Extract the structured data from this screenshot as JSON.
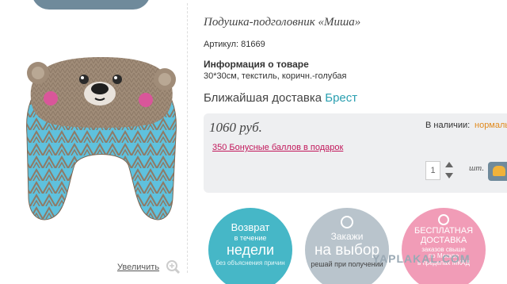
{
  "product": {
    "title": "Подушка-подголовник «Миша»",
    "article": "Артикул: 81669",
    "info_title": "Информация о товаре",
    "info_text": "30*30см, текстиль, коричн.-голубая",
    "delivery_label": "Ближайшая доставка",
    "delivery_city": "Брест",
    "zoom_label": "Увеличить"
  },
  "purchase": {
    "price": "1060 руб.",
    "stock_label": "В наличии:",
    "stock_value": "нормаль",
    "bonus_link": "350 Бонусные баллов в подарок",
    "quantity": "1",
    "unit": "шт."
  },
  "badges": {
    "return": {
      "l1": "Возврат",
      "l2": "в течение",
      "l3": "недели",
      "l4": "без объяснения причин"
    },
    "choice": {
      "l1": "Закажи",
      "l2": "на выбор",
      "l3": "решай при получении"
    },
    "delivery": {
      "l1": "БЕСПЛАТНАЯ",
      "l2": "ДОСТАВКА",
      "l3": "заказов свыше",
      "l4": "по Москве",
      "l5": "в пределах МКАД"
    }
  },
  "watermark": "YAPLAKAL.COM",
  "colors": {
    "accent": "#2a9fb0",
    "bonus": "#c2185b",
    "stock": "#e08a1e",
    "panel": "#eeeff1"
  }
}
